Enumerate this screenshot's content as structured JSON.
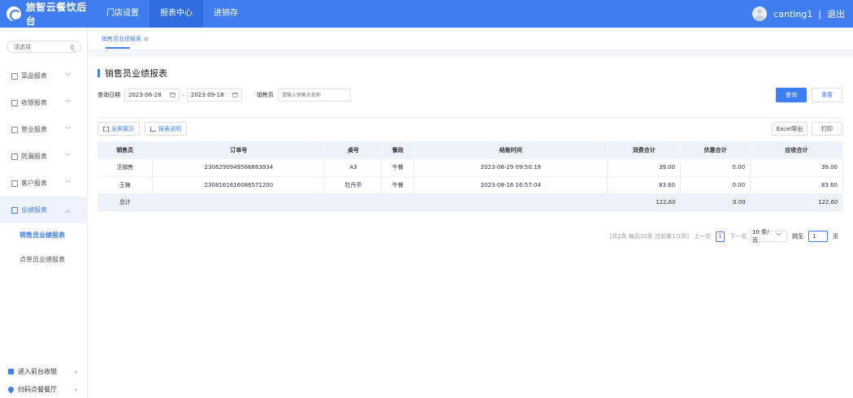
{
  "brand": {
    "name": "旅智云餐饮后台"
  },
  "nav": [
    {
      "label": "门店设置"
    },
    {
      "label": "报表中心"
    },
    {
      "label": "进销存"
    }
  ],
  "user": {
    "name": "canting1",
    "sep": "|",
    "logout": "退出"
  },
  "sidebar": {
    "search_placeholder": "请选择",
    "menus": [
      {
        "label": "菜品报表"
      },
      {
        "label": "收银报表"
      },
      {
        "label": "营业报表"
      },
      {
        "label": "防漏报表"
      },
      {
        "label": "客户报表"
      },
      {
        "label": "业绩报表"
      }
    ],
    "submenu": [
      {
        "label": "销售员业绩报表"
      },
      {
        "label": "点单员业绩报表"
      }
    ],
    "bottom": [
      {
        "label": "进入前台收银"
      },
      {
        "label": "扫码点餐餐厅"
      }
    ]
  },
  "tab": {
    "label": "销售员业绩报表"
  },
  "page": {
    "title": "销售员业绩报表"
  },
  "filters": {
    "date_label": "查询日期",
    "date_start": "2023-06-28",
    "date_end": "2023-09-18",
    "dash": "-",
    "seller_label": "销售员",
    "seller_placeholder": "请输入销售员名称"
  },
  "buttons": {
    "query": "查询",
    "reset": "重置",
    "fullscreen": "全屏展示",
    "report_desc": "报表说明",
    "excel": "Excel导出",
    "print": "打印"
  },
  "table": {
    "headers": [
      "销售员",
      "订单号",
      "桌号",
      "餐段",
      "结账时间",
      "消费合计",
      "优惠合计",
      "应收合计"
    ],
    "rows": [
      [
        "汪销售",
        "2306290949566863934",
        "A3",
        "午餐",
        "2023-06-29 09:50:19",
        "39.00",
        "0.00",
        "39.00"
      ],
      [
        "王梅",
        "2308161616086571200",
        "牡丹亭",
        "午餐",
        "2023-08-16 16:57:04",
        "83.60",
        "0.00",
        "83.60"
      ]
    ],
    "total": {
      "label": "总计",
      "consume": "122.60",
      "discount": "0.00",
      "receivable": "122.60"
    }
  },
  "pager": {
    "summary": "[共2条 每页10条 当前第1/1页]",
    "prev": "上一页",
    "current": "1",
    "next": "下一页",
    "page_size": "10 条/页",
    "jump_label": "跳至",
    "jump_value": "1",
    "page_unit": "页"
  },
  "colors": {
    "accent": "#3f7ef2",
    "header_bg": "#eef2fb"
  }
}
